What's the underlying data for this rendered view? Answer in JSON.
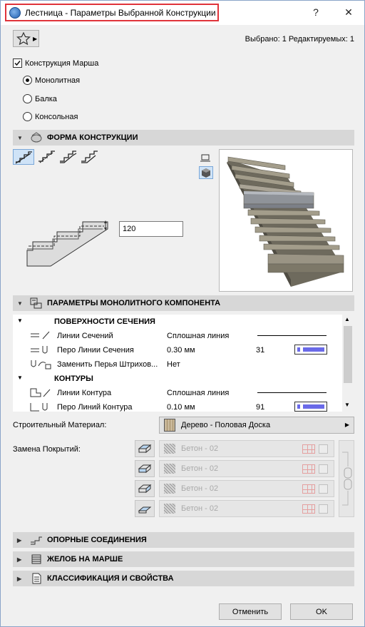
{
  "window": {
    "title": "Лестница - Параметры Выбранной Конструкции",
    "help_label": "?",
    "close_label": "✕"
  },
  "selection_info": "Выбрано: 1 Редактируемых: 1",
  "structure": {
    "checkbox_label": "Конструкция Марша",
    "checked": true,
    "options": [
      {
        "label": "Монолитная",
        "selected": true
      },
      {
        "label": "Балка",
        "selected": false
      },
      {
        "label": "Консольная",
        "selected": false
      }
    ]
  },
  "sections": {
    "shape": "ФОРМА КОНСТРУКЦИИ",
    "monolithic": "ПАРАМЕТРЫ МОНОЛИТНОГО КОМПОНЕНТА",
    "support": "ОПОРНЫЕ СОЕДИНЕНИЯ",
    "gutter": "ЖЕЛОБ НА МАРШЕ",
    "classification": "КЛАССИФИКАЦИЯ И СВОЙСТВА"
  },
  "shape": {
    "thickness_value": "120"
  },
  "params_table": {
    "groups": [
      {
        "title": "ПОВЕРХНОСТИ СЕЧЕНИЯ",
        "rows": [
          {
            "name": "Линии Сечений",
            "value": "Сплошная линия",
            "extra": ""
          },
          {
            "name": "Перо Линии Сечения",
            "value": "0.30 мм",
            "extra": "31"
          },
          {
            "name": "Заменить Перья Штрихов...",
            "value": "Нет",
            "extra": ""
          }
        ]
      },
      {
        "title": "КОНТУРЫ",
        "rows": [
          {
            "name": "Линии Контура",
            "value": "Сплошная линия",
            "extra": ""
          },
          {
            "name": "Перо Линий Контура",
            "value": "0.10 мм",
            "extra": "91"
          }
        ]
      }
    ],
    "pen_color": "#6a6ae8"
  },
  "material": {
    "label": "Строительный Материал:",
    "value": "Дерево - Половая Доска"
  },
  "covers": {
    "label": "Замена Покрытий:",
    "rows": [
      "Бетон - 02",
      "Бетон - 02",
      "Бетон - 02",
      "Бетон - 02"
    ]
  },
  "buttons": {
    "cancel": "Отменить",
    "ok": "OK"
  },
  "colors": {
    "title_highlight": "#e0333a",
    "header_bg": "#d7d7d7",
    "selected_tool": "#cfe3f7"
  }
}
